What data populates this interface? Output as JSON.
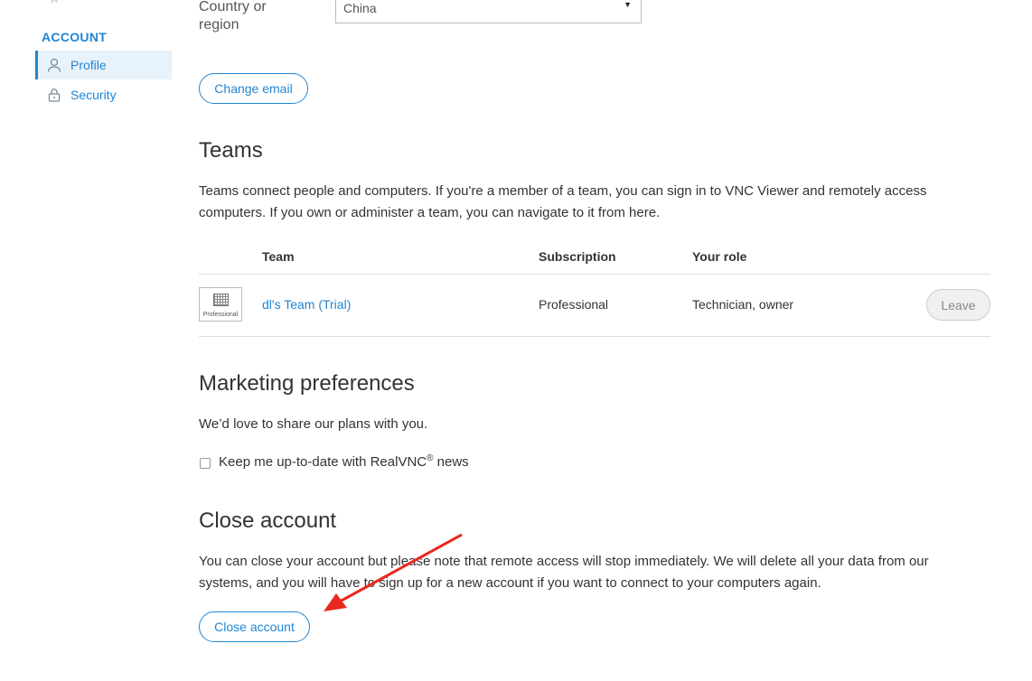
{
  "sidebar": {
    "heading": "ACCOUNT",
    "items": [
      {
        "label": "Profile",
        "icon": "user-icon",
        "active": true
      },
      {
        "label": "Security",
        "icon": "lock-icon",
        "active": false
      }
    ]
  },
  "profile": {
    "country_label": "Country or region",
    "country_value": "China",
    "change_email_label": "Change email"
  },
  "teams": {
    "title": "Teams",
    "description": "Teams connect people and computers. If you're a member of a team, you can sign in to VNC Viewer and remotely access computers. If you own or administer a team, you can navigate to it from here.",
    "columns": [
      "Team",
      "Subscription",
      "Your role"
    ],
    "rows": [
      {
        "logo_label": "Professional",
        "team": "dl's Team (Trial)",
        "subscription": "Professional",
        "role": "Technician, owner",
        "action": "Leave"
      }
    ]
  },
  "marketing": {
    "title": "Marketing preferences",
    "description": "We’d love to share our plans with you.",
    "checkbox_label": "Keep me up-to-date with RealVNC",
    "checkbox_sup": "®",
    "checkbox_suffix": " news",
    "checked": false
  },
  "close_account": {
    "title": "Close account",
    "description": "You can close your account but please note that remote access will stop immediately. We will delete all your data from our systems, and you will have to sign up for a new account if you want to connect to your computers again.",
    "button_label": "Close account"
  },
  "colors": {
    "accent": "#2186d4",
    "arrow": "#e8281e",
    "active_bg": "#e7f2fb"
  }
}
